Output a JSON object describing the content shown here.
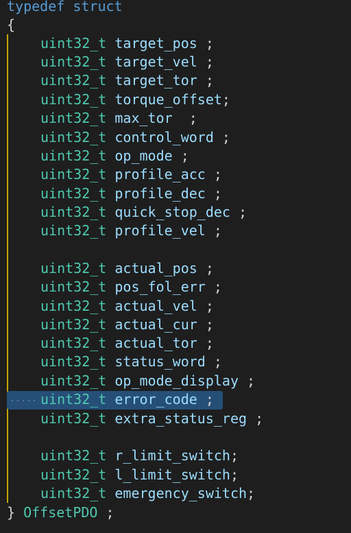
{
  "code": {
    "typedef_kw": "typedef",
    "struct_kw": "struct",
    "open_brace": "{",
    "close_brace": "}",
    "struct_name": "OffsetPDO",
    "semicolon": ";",
    "member_type": "uint32_t",
    "members": [
      {
        "name": "target_pos",
        "tail": " ;"
      },
      {
        "name": "target_vel",
        "tail": " ;"
      },
      {
        "name": "target_tor",
        "tail": " ;"
      },
      {
        "name": "torque_offset",
        "tail": ";"
      },
      {
        "name": "max_tor",
        "tail": "  ;"
      },
      {
        "name": "control_word",
        "tail": " ;"
      },
      {
        "name": "op_mode",
        "tail": " ;"
      },
      {
        "name": "profile_acc",
        "tail": " ;"
      },
      {
        "name": "profile_dec",
        "tail": " ;"
      },
      {
        "name": "quick_stop_dec",
        "tail": " ;"
      },
      {
        "name": "profile_vel",
        "tail": " ;"
      },
      {
        "name": "actual_pos",
        "tail": " ;"
      },
      {
        "name": "pos_fol_err",
        "tail": " ;"
      },
      {
        "name": "actual_vel",
        "tail": " ;"
      },
      {
        "name": "actual_cur",
        "tail": " ;"
      },
      {
        "name": "actual_tor",
        "tail": " ;"
      },
      {
        "name": "status_word",
        "tail": " ;"
      },
      {
        "name": "op_mode_display",
        "tail": " ;"
      },
      {
        "name": "error_code",
        "tail": " ;"
      },
      {
        "name": "extra_status_reg",
        "tail": " ;"
      },
      {
        "name": "r_limit_switch",
        "tail": ";"
      },
      {
        "name": "l_limit_switch",
        "tail": ";"
      },
      {
        "name": "emergency_switch",
        "tail": ";"
      }
    ]
  },
  "colors": {
    "background": "#1e1e1e",
    "keyword": "#569cd6",
    "type": "#4ec9b0",
    "identifier": "#9cdcfe",
    "punctuation": "#d4d4d4",
    "indent_guide": "#c9a500",
    "selection": "#264f78"
  }
}
